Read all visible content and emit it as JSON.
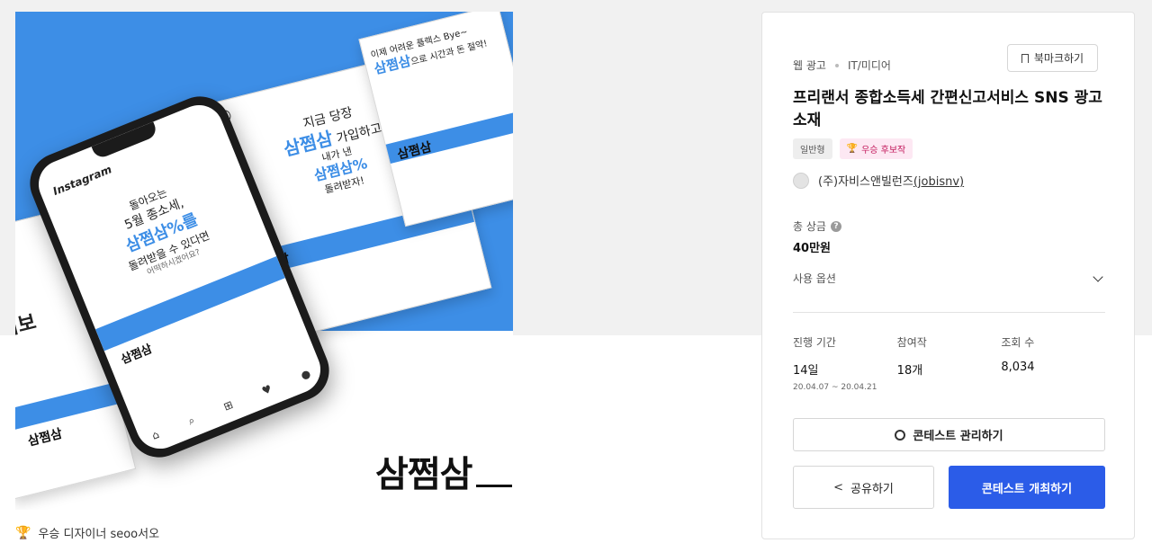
{
  "artwork": {
    "brand_text": "삼쩜삼",
    "phone": {
      "app_name": "Instagram",
      "headline_1": "돌아오는",
      "headline_2": "5월 종소세,",
      "headline_big": "삼쩜삼%를",
      "headline_3": "돌려받을 수 있다면",
      "headline_4": "어떡하시겠어요?",
      "post_label": "삼쩜삼"
    },
    "post_center": {
      "line1": "지금 당장",
      "line2_blue": "삼쩜삼",
      "line2_rest": "가입하고",
      "line3": "내가 낸",
      "line4_blue": "삼쩜삼%",
      "line5": "돌려받자!",
      "label": "삼쩜삼"
    },
    "post_right": {
      "line1": "이제 어려운 플렉스 Bye~",
      "line2_blue": "삼쩜삼",
      "line2_rest": "으로 시간과 돈 절약!",
      "label": "삼쩜삼"
    },
    "post_left": {
      "text": "의보",
      "label": "삼쩜삼"
    }
  },
  "winner": {
    "text": "우승 디자이너 seoo서오"
  },
  "panel": {
    "category_primary": "웹 광고",
    "category_secondary": "IT/미디어",
    "bookmark_label": "북마크하기",
    "title": "프리랜서 종합소득세 간편신고서비스 SNS 광고 소재",
    "badge_type": "일반형",
    "badge_status": "우승 후보작",
    "host_name": "(주)자비스앤빌런즈",
    "host_id": "(jobisnv)",
    "prize_label": "총 상금",
    "prize_value": "40만원",
    "options_label": "사용 옵션",
    "stats": {
      "period_label": "진행 기간",
      "period_value": "14일",
      "period_range": "20.04.07 ~ 20.04.21",
      "entries_label": "참여작",
      "entries_value": "18개",
      "views_label": "조회 수",
      "views_value": "8,034"
    },
    "manage_label": "콘테스트 관리하기",
    "share_label": "공유하기",
    "host_contest_label": "콘테스트 개최하기"
  },
  "colors": {
    "accent_blue": "#2b5ce8",
    "art_blue": "#3d8ee6",
    "badge_pink_text": "#c2185b",
    "badge_pink_bg": "#fde8f3"
  }
}
